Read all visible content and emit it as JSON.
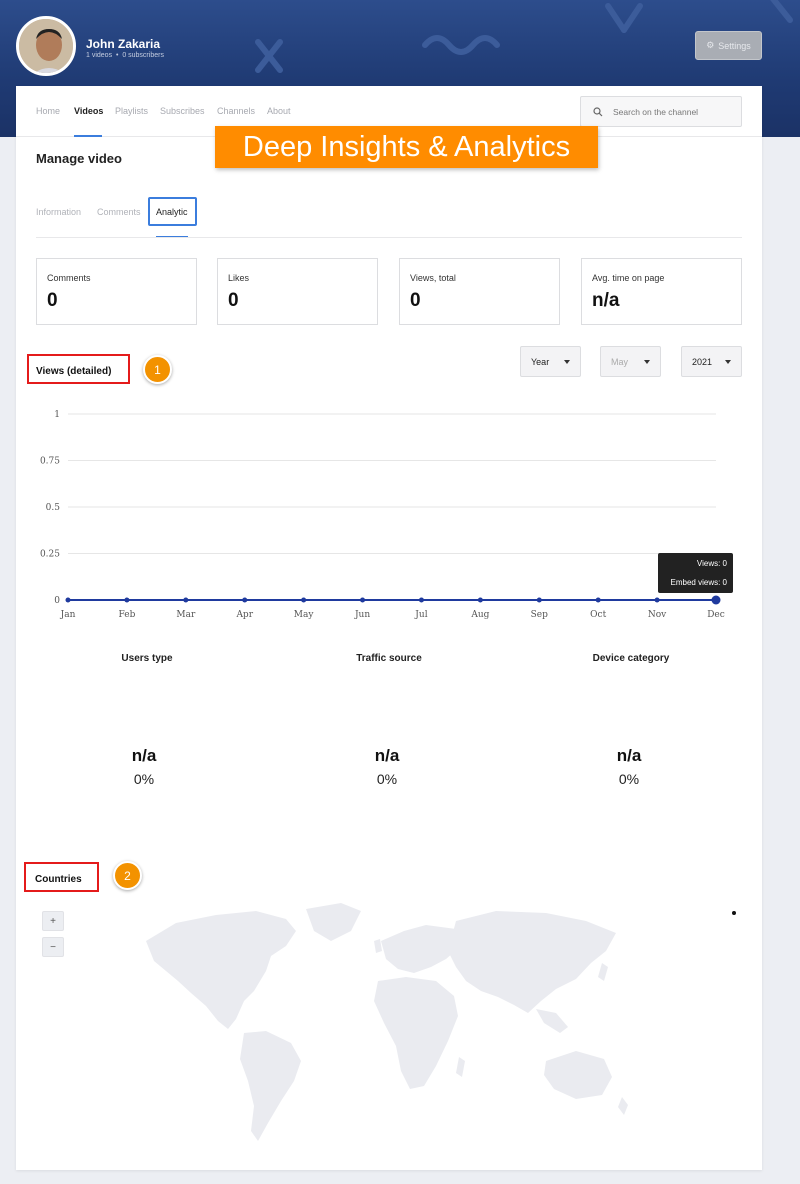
{
  "channel": {
    "name": "John Zakaria",
    "videos": "1 videos",
    "subscribers": "0 subscribers",
    "settings_label": "Settings"
  },
  "nav": {
    "items": [
      "Home",
      "Videos",
      "Playlists",
      "Subscribes",
      "Channels",
      "About"
    ],
    "search_placeholder": "Search on the channel"
  },
  "promo_banner": "Deep Insights & Analytics",
  "manage": {
    "title": "Manage video",
    "tabs": [
      "Information",
      "Comments",
      "Analytic"
    ]
  },
  "stats": [
    {
      "label": "Comments",
      "value": "0"
    },
    {
      "label": "Likes",
      "value": "0"
    },
    {
      "label": "Views, total",
      "value": "0"
    },
    {
      "label": "Avg. time on page",
      "value": "n/a"
    }
  ],
  "views_section": {
    "title": "Views (detailed)",
    "badge": "1",
    "filters": {
      "period": "Year",
      "month": "May",
      "year": "2021"
    }
  },
  "tooltip": {
    "views": "Views: 0",
    "embed_views": "Embed views: 0"
  },
  "chart_data": {
    "type": "line",
    "categories": [
      "Jan",
      "Feb",
      "Mar",
      "Apr",
      "May",
      "Jun",
      "Jul",
      "Aug",
      "Sep",
      "Oct",
      "Nov",
      "Dec"
    ],
    "series": [
      {
        "values": [
          0,
          0,
          0,
          0,
          0,
          0,
          0,
          0,
          0,
          0,
          0,
          0
        ]
      }
    ],
    "yticks": [
      "0",
      "0.25",
      "0.5",
      "0.75",
      "1"
    ],
    "ylim": [
      0,
      1
    ],
    "grid": true,
    "title": "",
    "xlabel": "",
    "ylabel": "",
    "line_color": "#1f3a9e"
  },
  "breakdowns": [
    {
      "title": "Users type",
      "value": "n/a",
      "percent": "0%"
    },
    {
      "title": "Traffic source",
      "value": "n/a",
      "percent": "0%"
    },
    {
      "title": "Device category",
      "value": "n/a",
      "percent": "0%"
    }
  ],
  "countries_section": {
    "title": "Countries",
    "badge": "2",
    "zoom_in": "+",
    "zoom_out": "−"
  },
  "colors": {
    "accent": "#3b7ddd",
    "promo": "#ff8c00",
    "badge": "#f39200",
    "highlight_box": "#e41b1b"
  }
}
